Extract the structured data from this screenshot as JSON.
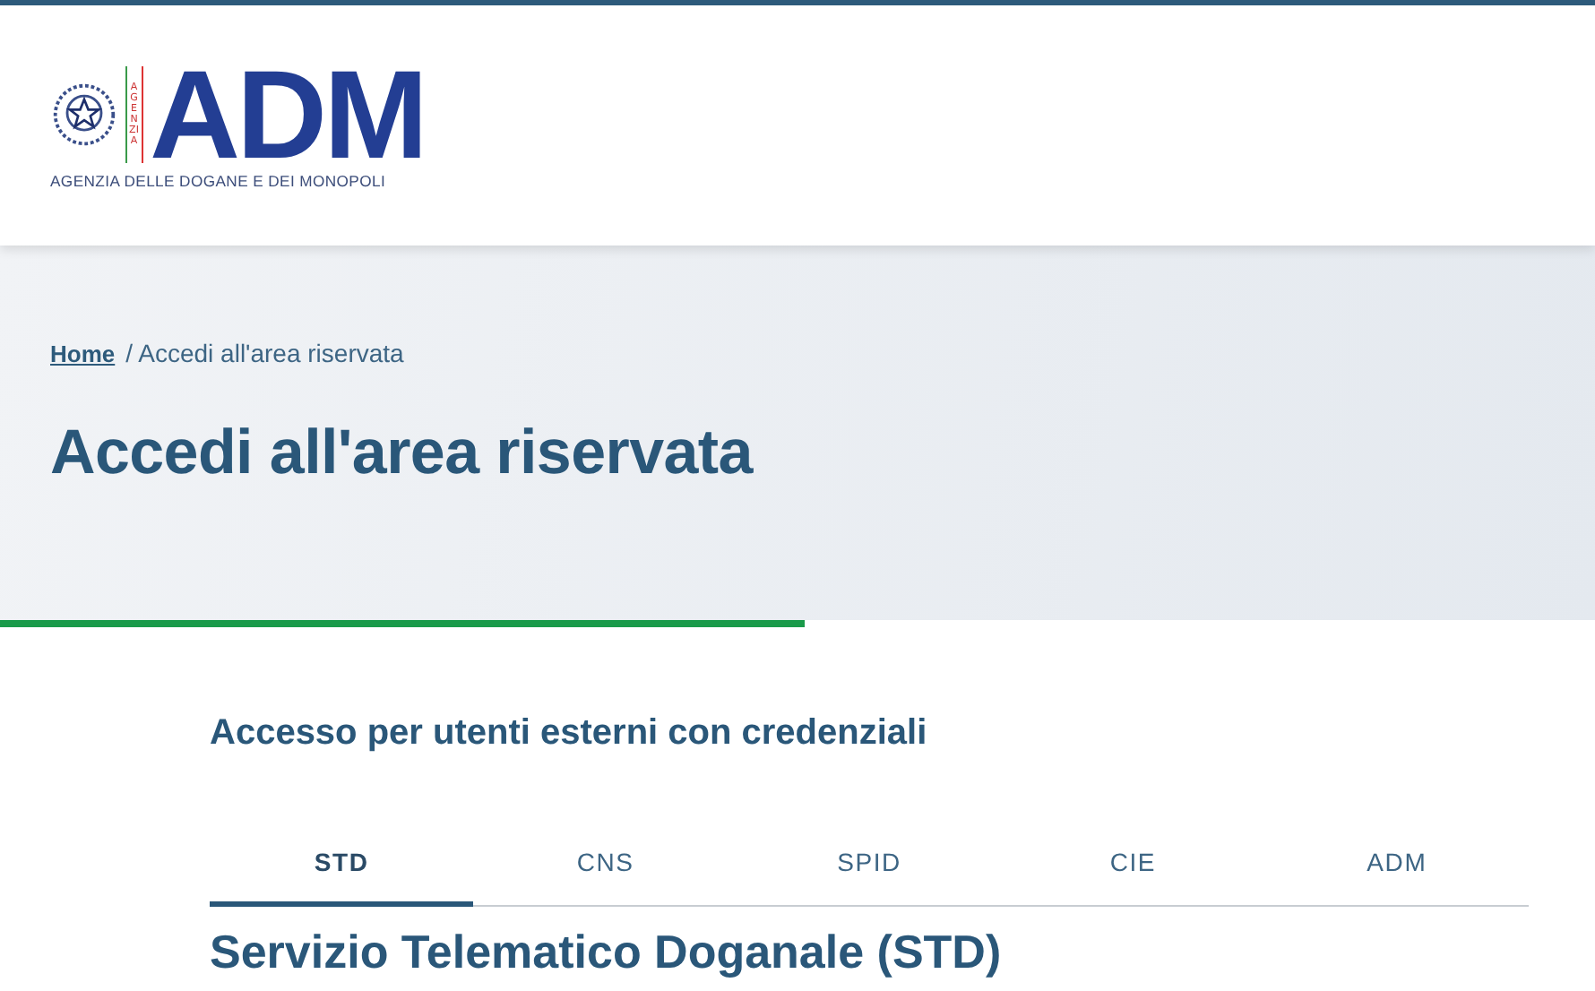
{
  "logo": {
    "mark": "ADM",
    "vertical": "AGENZIA",
    "subtitle": "AGENZIA DELLE DOGANE E DEI MONOPOLI"
  },
  "breadcrumb": [
    {
      "label": "Home",
      "kind": "link"
    },
    {
      "label": "/ Accedi all'area riservata",
      "kind": "current"
    }
  ],
  "page_title": "Accedi all'area riservata",
  "progress": {
    "level": 0.505
  },
  "section_title": "Accesso per utenti esterni con credenziali",
  "tabs": [
    {
      "label": "STD",
      "selected": true
    },
    {
      "label": "CNS",
      "selected": false
    },
    {
      "label": "SPID",
      "selected": false
    },
    {
      "label": "CIE",
      "selected": false
    },
    {
      "label": "ADM",
      "selected": false
    }
  ],
  "panel_title": "Servizio Telematico Doganale (STD)"
}
